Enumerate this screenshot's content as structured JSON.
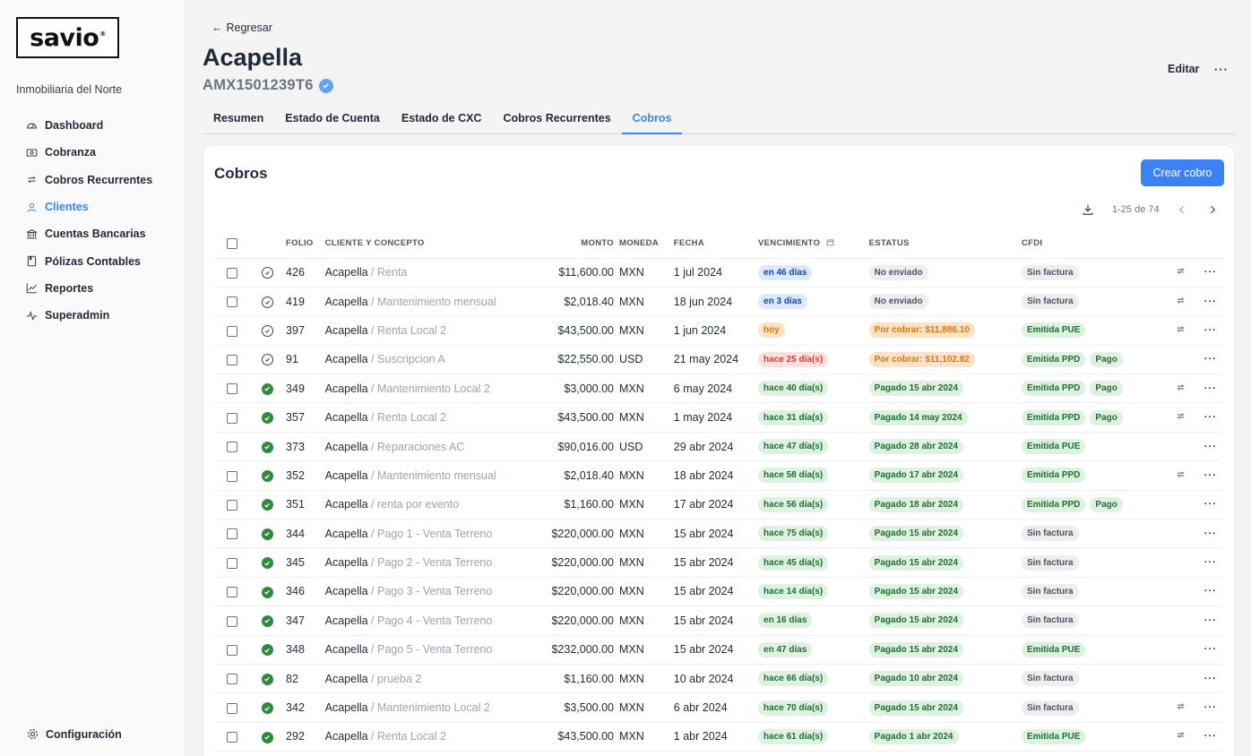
{
  "sidebar": {
    "logo": "savio",
    "org": "Inmobiliaria del Norte",
    "items": [
      {
        "label": "Dashboard",
        "icon": "gauge-icon"
      },
      {
        "label": "Cobranza",
        "icon": "cash-icon"
      },
      {
        "label": "Cobros Recurrentes",
        "icon": "repeat-icon"
      },
      {
        "label": "Clientes",
        "icon": "user-icon",
        "active": true
      },
      {
        "label": "Cuentas Bancarias",
        "icon": "bank-icon"
      },
      {
        "label": "Pólizas Contables",
        "icon": "book-icon"
      },
      {
        "label": "Reportes",
        "icon": "chart-icon"
      },
      {
        "label": "Superadmin",
        "icon": "pulse-icon"
      }
    ],
    "config": "Configuración"
  },
  "header": {
    "back": "Regresar",
    "title": "Acapella",
    "rfc": "AMX1501239T6",
    "edit": "Editar",
    "more": "···"
  },
  "tabs": [
    {
      "label": "Resumen"
    },
    {
      "label": "Estado de Cuenta"
    },
    {
      "label": "Estado de CXC"
    },
    {
      "label": "Cobros Recurrentes"
    },
    {
      "label": "Cobros",
      "active": true
    }
  ],
  "panel": {
    "title": "Cobros",
    "create": "Crear cobro",
    "pager": "1-25 de 74"
  },
  "columns": {
    "folio": "FOLIO",
    "cliente": "CLIENTE Y CONCEPTO",
    "monto": "MONTO",
    "moneda": "MONEDA",
    "fecha": "FECHA",
    "vencimiento": "VENCIMIENTO",
    "estatus": "ESTATUS",
    "cfdi": "CFDI"
  },
  "colors": {
    "accent": "#3b82f6",
    "paid": "#2f8a3e"
  },
  "rows": [
    {
      "status": "open",
      "folio": "426",
      "cliente": "Acapella",
      "concepto": "Renta",
      "monto": "$11,600.00",
      "moneda": "MXN",
      "fecha": "1 jul 2024",
      "venc": {
        "text": "en 46 días",
        "color": "blue"
      },
      "estatus": {
        "text": "No enviado",
        "color": "gray"
      },
      "cfdi": [
        {
          "text": "Sin factura",
          "color": "gray"
        }
      ],
      "recurrent": true
    },
    {
      "status": "open",
      "folio": "419",
      "cliente": "Acapella",
      "concepto": "Mantenimiento mensual",
      "monto": "$2,018.40",
      "moneda": "MXN",
      "fecha": "18 jun 2024",
      "venc": {
        "text": "en 3 días",
        "color": "blue"
      },
      "estatus": {
        "text": "No enviado",
        "color": "gray"
      },
      "cfdi": [
        {
          "text": "Sin factura",
          "color": "gray"
        }
      ],
      "recurrent": true
    },
    {
      "status": "open",
      "folio": "397",
      "cliente": "Acapella",
      "concepto": "Renta Local 2",
      "monto": "$43,500.00",
      "moneda": "MXN",
      "fecha": "1 jun 2024",
      "venc": {
        "text": "hoy",
        "color": "orange"
      },
      "estatus": {
        "text": "Por cobrar: $11,886.10",
        "color": "orange"
      },
      "cfdi": [
        {
          "text": "Emitida PUE",
          "color": "green"
        }
      ],
      "recurrent": true
    },
    {
      "status": "open",
      "folio": "91",
      "cliente": "Acapella",
      "concepto": "Suscripcion A",
      "monto": "$22,550.00",
      "moneda": "USD",
      "fecha": "21 may 2024",
      "venc": {
        "text": "hace 25 día(s)",
        "color": "red"
      },
      "estatus": {
        "text": "Por cobrar: $11,102.82",
        "color": "orange"
      },
      "cfdi": [
        {
          "text": "Emitida PPD",
          "color": "green"
        },
        {
          "text": "Pago",
          "color": "green"
        }
      ],
      "recurrent": false
    },
    {
      "status": "paid",
      "folio": "349",
      "cliente": "Acapella",
      "concepto": "Mantenimiento Local 2",
      "monto": "$3,000.00",
      "moneda": "MXN",
      "fecha": "6 may 2024",
      "venc": {
        "text": "hace 40 día(s)",
        "color": "green"
      },
      "estatus": {
        "text": "Pagado 15 abr 2024",
        "color": "green"
      },
      "cfdi": [
        {
          "text": "Emitida PPD",
          "color": "green"
        },
        {
          "text": "Pago",
          "color": "green"
        }
      ],
      "recurrent": true
    },
    {
      "status": "paid",
      "folio": "357",
      "cliente": "Acapella",
      "concepto": "Renta Local 2",
      "monto": "$43,500.00",
      "moneda": "MXN",
      "fecha": "1 may 2024",
      "venc": {
        "text": "hace 31 día(s)",
        "color": "green"
      },
      "estatus": {
        "text": "Pagado 14 may 2024",
        "color": "green"
      },
      "cfdi": [
        {
          "text": "Emitida PPD",
          "color": "green"
        },
        {
          "text": "Pago",
          "color": "green"
        }
      ],
      "recurrent": true
    },
    {
      "status": "paid",
      "folio": "373",
      "cliente": "Acapella",
      "concepto": "Reparaciones AC",
      "monto": "$90,016.00",
      "moneda": "USD",
      "fecha": "29 abr 2024",
      "venc": {
        "text": "hace 47 día(s)",
        "color": "green"
      },
      "estatus": {
        "text": "Pagado 28 abr 2024",
        "color": "green"
      },
      "cfdi": [
        {
          "text": "Emitida PUE",
          "color": "green"
        }
      ],
      "recurrent": false
    },
    {
      "status": "paid",
      "folio": "352",
      "cliente": "Acapella",
      "concepto": "Mantenimiento mensual",
      "monto": "$2,018.40",
      "moneda": "MXN",
      "fecha": "18 abr 2024",
      "venc": {
        "text": "hace 58 día(s)",
        "color": "green"
      },
      "estatus": {
        "text": "Pagado 17 abr 2024",
        "color": "green"
      },
      "cfdi": [
        {
          "text": "Emitida PPD",
          "color": "green"
        }
      ],
      "recurrent": true
    },
    {
      "status": "paid",
      "folio": "351",
      "cliente": "Acapella",
      "concepto": "renta por evento",
      "monto": "$1,160.00",
      "moneda": "MXN",
      "fecha": "17 abr 2024",
      "venc": {
        "text": "hace 56 día(s)",
        "color": "green"
      },
      "estatus": {
        "text": "Pagado 18 abr 2024",
        "color": "green"
      },
      "cfdi": [
        {
          "text": "Emitida PPD",
          "color": "green"
        },
        {
          "text": "Pago",
          "color": "green"
        }
      ],
      "recurrent": false
    },
    {
      "status": "paid",
      "folio": "344",
      "cliente": "Acapella",
      "concepto": "Pago 1 - Venta Terreno",
      "monto": "$220,000.00",
      "moneda": "MXN",
      "fecha": "15 abr 2024",
      "venc": {
        "text": "hace 75 día(s)",
        "color": "green"
      },
      "estatus": {
        "text": "Pagado 15 abr 2024",
        "color": "green"
      },
      "cfdi": [
        {
          "text": "Sin factura",
          "color": "gray"
        }
      ],
      "recurrent": false
    },
    {
      "status": "paid",
      "folio": "345",
      "cliente": "Acapella",
      "concepto": "Pago 2 - Venta Terreno",
      "monto": "$220,000.00",
      "moneda": "MXN",
      "fecha": "15 abr 2024",
      "venc": {
        "text": "hace 45 día(s)",
        "color": "green"
      },
      "estatus": {
        "text": "Pagado 15 abr 2024",
        "color": "green"
      },
      "cfdi": [
        {
          "text": "Sin factura",
          "color": "gray"
        }
      ],
      "recurrent": false
    },
    {
      "status": "paid",
      "folio": "346",
      "cliente": "Acapella",
      "concepto": "Pago 3 - Venta Terreno",
      "monto": "$220,000.00",
      "moneda": "MXN",
      "fecha": "15 abr 2024",
      "venc": {
        "text": "hace 14 día(s)",
        "color": "green"
      },
      "estatus": {
        "text": "Pagado 15 abr 2024",
        "color": "green"
      },
      "cfdi": [
        {
          "text": "Sin factura",
          "color": "gray"
        }
      ],
      "recurrent": false
    },
    {
      "status": "paid",
      "folio": "347",
      "cliente": "Acapella",
      "concepto": "Pago 4 - Venta Terreno",
      "monto": "$220,000.00",
      "moneda": "MXN",
      "fecha": "15 abr 2024",
      "venc": {
        "text": "en 16 días",
        "color": "green"
      },
      "estatus": {
        "text": "Pagado 15 abr 2024",
        "color": "green"
      },
      "cfdi": [
        {
          "text": "Sin factura",
          "color": "gray"
        }
      ],
      "recurrent": false
    },
    {
      "status": "paid",
      "folio": "348",
      "cliente": "Acapella",
      "concepto": "Pago 5 - Venta Terreno",
      "monto": "$232,000.00",
      "moneda": "MXN",
      "fecha": "15 abr 2024",
      "venc": {
        "text": "en 47 días",
        "color": "green"
      },
      "estatus": {
        "text": "Pagado 15 abr 2024",
        "color": "green"
      },
      "cfdi": [
        {
          "text": "Emitida PUE",
          "color": "green"
        }
      ],
      "recurrent": false
    },
    {
      "status": "paid",
      "folio": "82",
      "cliente": "Acapella",
      "concepto": "prueba 2",
      "monto": "$1,160.00",
      "moneda": "MXN",
      "fecha": "10 abr 2024",
      "venc": {
        "text": "hace 66 día(s)",
        "color": "green"
      },
      "estatus": {
        "text": "Pagado 10 abr 2024",
        "color": "green"
      },
      "cfdi": [
        {
          "text": "Sin factura",
          "color": "gray"
        }
      ],
      "recurrent": false
    },
    {
      "status": "paid",
      "folio": "342",
      "cliente": "Acapella",
      "concepto": "Mantenimiento Local 2",
      "monto": "$3,500.00",
      "moneda": "MXN",
      "fecha": "6 abr 2024",
      "venc": {
        "text": "hace 70 día(s)",
        "color": "green"
      },
      "estatus": {
        "text": "Pagado 15 abr 2024",
        "color": "green"
      },
      "cfdi": [
        {
          "text": "Sin factura",
          "color": "gray"
        }
      ],
      "recurrent": true
    },
    {
      "status": "paid",
      "folio": "292",
      "cliente": "Acapella",
      "concepto": "Renta Local 2",
      "monto": "$43,500.00",
      "moneda": "MXN",
      "fecha": "1 abr 2024",
      "venc": {
        "text": "hace 61 día(s)",
        "color": "green"
      },
      "estatus": {
        "text": "Pagado 1 abr 2024",
        "color": "green"
      },
      "cfdi": [
        {
          "text": "Emitida PUE",
          "color": "green"
        }
      ],
      "recurrent": true
    }
  ]
}
